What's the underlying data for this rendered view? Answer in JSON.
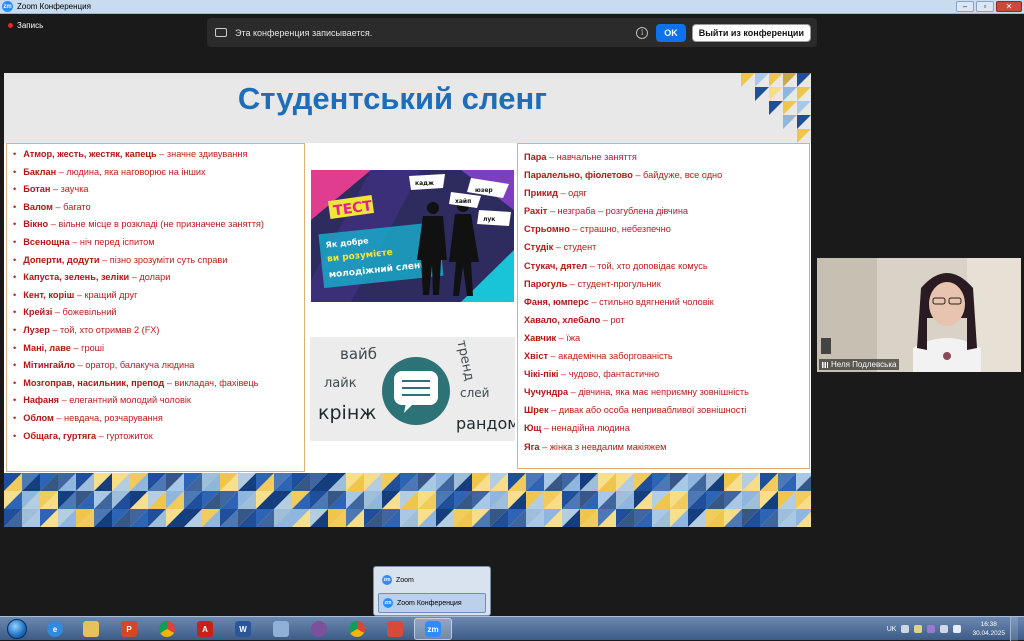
{
  "window": {
    "title": "Zoom Конференция"
  },
  "recording": {
    "label": "Запись"
  },
  "banner": {
    "message": "Эта конференция записывается.",
    "ok_label": "OK",
    "leave_label": "Выйти из конференции"
  },
  "slide": {
    "title": "Студентський сленг",
    "left_items": [
      {
        "term": "Атмор, жесть, жестяк, капець",
        "def": " – значне здивування"
      },
      {
        "term": "Баклан",
        "def": " – людина, яка наговорює на інших"
      },
      {
        "term": "Ботан",
        "def": "  – заучка"
      },
      {
        "term": "Валом",
        "def": " – багато"
      },
      {
        "term": "Вікно",
        "def": " – вільне місце в розкладі (не призначене заняття)"
      },
      {
        "term": "Всенощна",
        "def": " – ніч перед іспитом"
      },
      {
        "term": "Доперти, додути",
        "def": " – пізно зрозуміти суть справи"
      },
      {
        "term": "Капуста, зелень, зеліки",
        "def": " – долари"
      },
      {
        "term": "Кент, коріш",
        "def": " – кращий друг"
      },
      {
        "term": "Крейзі",
        "def": " – божевільний"
      },
      {
        "term": "Лузер",
        "def": " – той, хто отримав 2 (FX)"
      },
      {
        "term": "Мані, лаве",
        "def": " – гроші"
      },
      {
        "term": "Мітингайло",
        "def": " – оратор, балакуча людина"
      },
      {
        "term": "Мозгоправ, насильник, препод",
        "def": " – викладач, фахівець"
      },
      {
        "term": "Нафаня",
        "def": " – елегантний молодий чоловік"
      },
      {
        "term": "Облом",
        "def": " – невдача, розчарування"
      },
      {
        "term": "Общага, гуртяга",
        "def": " – гуртожиток"
      }
    ],
    "right_items": [
      {
        "term": "Пара",
        "def": " – навчальне заняття"
      },
      {
        "term": "Паралельно, фіолетово",
        "def": " – байдуже, все одно"
      },
      {
        "term": "Прикид",
        "def": " – одяг"
      },
      {
        "term": "Рахіт",
        "def": " – незграба – розгублена дівчина"
      },
      {
        "term": "Стрьомно",
        "def": " – страшно, небезпечно"
      },
      {
        "term": "Студік",
        "def": " – студент"
      },
      {
        "term": "Стукач, дятел",
        "def": " – той, хто доповідає комусь"
      },
      {
        "term": "Парогуль",
        "def": " – студент-прогульник"
      },
      {
        "term": "Фаня, юмперс",
        "def": " – стильно вдягнений чоловік"
      },
      {
        "term": "Хавало, хлебало",
        "def": " – рот"
      },
      {
        "term": "Хавчик",
        "def": " – їжа"
      },
      {
        "term": "Хвіст",
        "def": " – академічна заборгованість"
      },
      {
        "term": "Чікі-пікі",
        "def": " –  чудово, фантастично"
      },
      {
        "term": "Чучундра",
        "def": " – дівчина, яка має неприємну зовнішність"
      },
      {
        "term": "Шрек",
        "def": " – дивак або особа непривабливої зовнішності"
      },
      {
        "term": "Ющ",
        "def": " – ненадійна людина"
      },
      {
        "term": "Яга",
        "def": " – жінка з невдалим макіяжем"
      }
    ],
    "test_image": {
      "word_test": "ТЕСТ",
      "line1": "Як добре",
      "line2": "ви розумієте",
      "line3": "молодіжний сленг?",
      "bubbles": [
        "кадж",
        "юзер",
        "хайп",
        "лук"
      ]
    },
    "words_image": {
      "words": [
        "вайб",
        "тренд",
        "лайк",
        "крінж",
        "слей",
        "рандом"
      ]
    }
  },
  "participant": {
    "name": "Неля Подлевська"
  },
  "taskbar_popup": {
    "items": [
      "Zoom",
      "Zoom Конференция"
    ]
  },
  "tray": {
    "lang": "UK",
    "time": "16:38",
    "date": "30.04.2025"
  },
  "colors": {
    "title_blue": "#1f6db8",
    "term_red": "#b71515",
    "zoom_blue": "#2d8cff",
    "ok_blue": "#0e72ed"
  }
}
